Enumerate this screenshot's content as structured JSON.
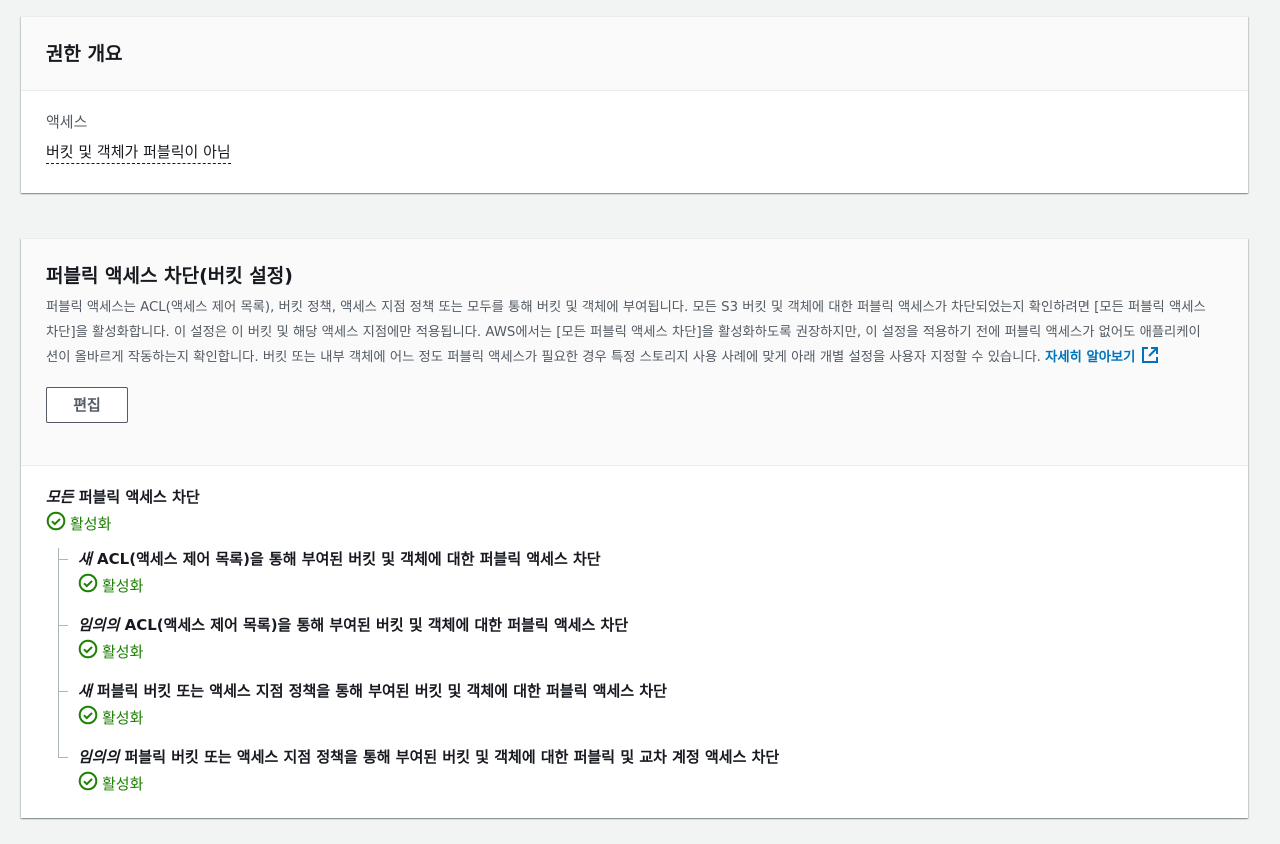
{
  "overview": {
    "title": "권한 개요",
    "access_label": "액세스",
    "access_value": "버킷 및 객체가 퍼블릭이 아님"
  },
  "block_public": {
    "title": "퍼블릭 액세스 차단(버킷 설정)",
    "description": "퍼블릭 액세스는 ACL(액세스 제어 목록), 버킷 정책, 액세스 지점 정책 또는 모두를 통해 버킷 및 객체에 부여됩니다. 모든 S3 버킷 및 객체에 대한 퍼블릭 액세스가 차단되었는지 확인하려면 [모든 퍼블릭 액세스 차단]을 활성화합니다. 이 설정은 이 버킷 및 해당 액세스 지점에만 적용됩니다. AWS에서는 [모든 퍼블릭 액세스 차단]을 활성화하도록 권장하지만, 이 설정을 적용하기 전에 퍼블릭 액세스가 없어도 애플리케이션이 올바르게 작동하는지 확인합니다. 버킷 또는 내부 객체에 어느 정도 퍼블릭 액세스가 필요한 경우 특정 스토리지 사용 사례에 맞게 아래 개별 설정을 사용자 지정할 수 있습니다.",
    "learn_more": "자세히 알아보기",
    "edit_button": "편집",
    "main_setting": {
      "emph": "모든",
      "rest": " 퍼블릭 액세스 차단",
      "status": "활성화"
    },
    "sub_settings": [
      {
        "emph": "새",
        "rest": " ACL(액세스 제어 목록)을 통해 부여된 버킷 및 객체에 대한 퍼블릭 액세스 차단",
        "status": "활성화"
      },
      {
        "emph": "임의의",
        "rest": " ACL(액세스 제어 목록)을 통해 부여된 버킷 및 객체에 대한 퍼블릭 액세스 차단",
        "status": "활성화"
      },
      {
        "emph": "새",
        "rest": " 퍼블릭 버킷 또는 액세스 지점 정책을 통해 부여된 버킷 및 객체에 대한 퍼블릭 액세스 차단",
        "status": "활성화"
      },
      {
        "emph": "임의의",
        "rest": " 퍼블릭 버킷 또는 액세스 지점 정책을 통해 부여된 버킷 및 객체에 대한 퍼블릭 및 교차 계정 액세스 차단",
        "status": "활성화"
      }
    ]
  },
  "colors": {
    "success": "#1d8102",
    "link": "#0073bb",
    "text": "#16191f",
    "muted": "#545b64"
  }
}
